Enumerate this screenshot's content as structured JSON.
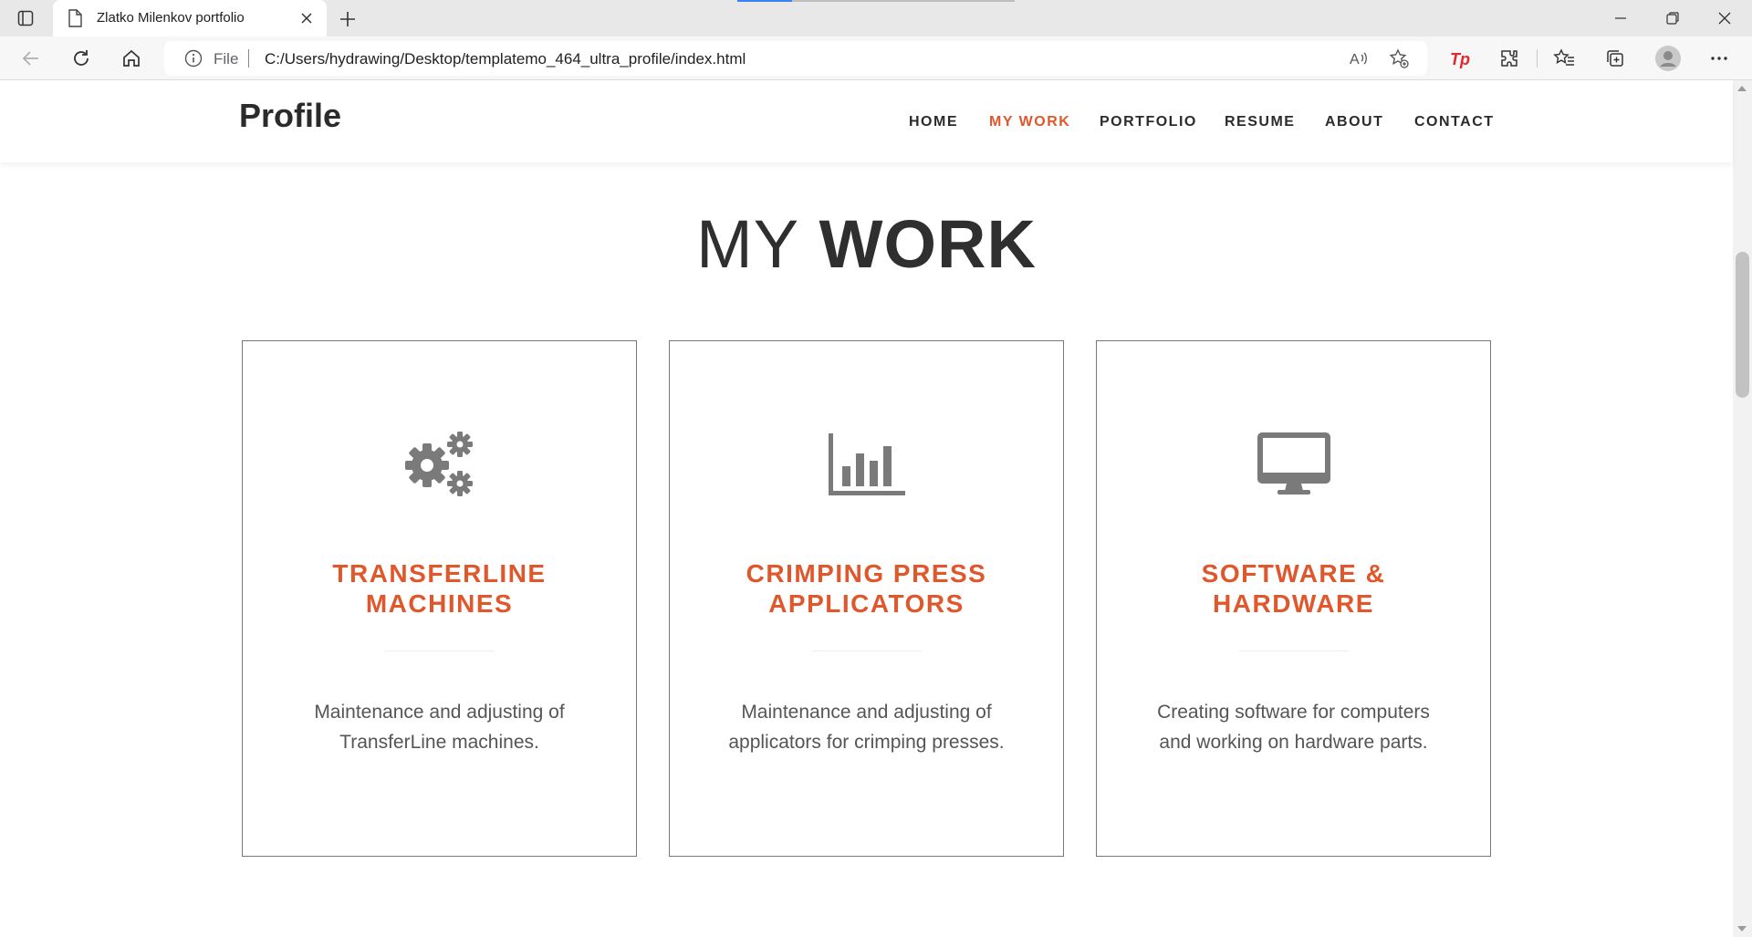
{
  "browser": {
    "tab_title": "Zlatko Milenkov portfolio",
    "address_scheme": "File",
    "address_url": "C:/Users/hydrawing/Desktop/templatemo_464_ultra_profile/index.html",
    "icons": [
      "tab-actions-icon",
      "page-icon",
      "close-icon",
      "new-tab-icon",
      "back-icon",
      "reload-icon",
      "home-icon",
      "info-icon",
      "read-aloud-icon",
      "add-favorite-icon",
      "tp-extension-icon",
      "extensions-icon",
      "favorites-icon",
      "collections-icon",
      "profile-icon",
      "more-icon",
      "minimize-icon",
      "maximize-icon",
      "close-window-icon"
    ]
  },
  "site": {
    "brand": "Profile",
    "nav": [
      {
        "label": "HOME",
        "active": false
      },
      {
        "label": "MY WORK",
        "active": true
      },
      {
        "label": "PORTFOLIO",
        "active": false
      },
      {
        "label": "RESUME",
        "active": false
      },
      {
        "label": "ABOUT",
        "active": false
      },
      {
        "label": "CONTACT",
        "active": false
      }
    ],
    "accent_color": "#e0572b"
  },
  "section": {
    "title_light": "MY",
    "title_bold": "WORK",
    "cards": [
      {
        "icon": "gears-icon",
        "title_line1": "TRANSFERLINE",
        "title_line2": "MACHINES",
        "text_line1": "Maintenance and adjusting of",
        "text_line2": "TransferLine machines."
      },
      {
        "icon": "bar-chart-icon",
        "title_line1": "CRIMPING PRESS",
        "title_line2": "APPLICATORS",
        "text_line1": "Maintenance and adjusting of",
        "text_line2": "applicators for crimping presses."
      },
      {
        "icon": "desktop-icon",
        "title_line1": "SOFTWARE &",
        "title_line2": "HARDWARE",
        "text_line1": "Creating software for computers",
        "text_line2": "and working on hardware parts."
      }
    ]
  }
}
